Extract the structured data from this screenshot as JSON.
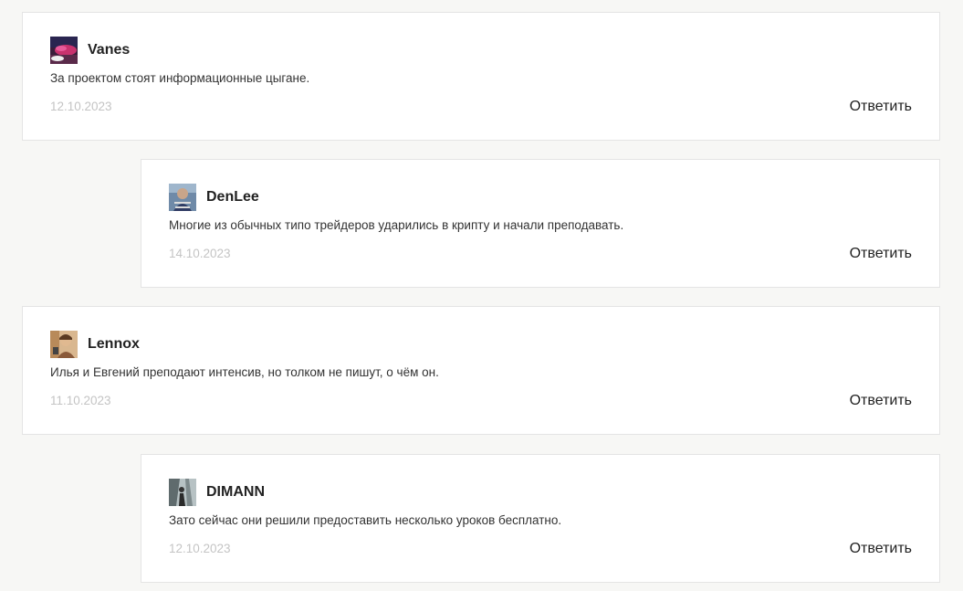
{
  "comments": [
    {
      "author": "Vanes",
      "text": "За проектом стоят информационные цыгане.",
      "date": "12.10.2023",
      "reply_label": "Ответить",
      "avatar_icon": "avatar-photo"
    },
    {
      "author": "DenLee",
      "text": "Многие из обычных типо трейдеров ударились в крипту и начали преподавать.",
      "date": "14.10.2023",
      "reply_label": "Ответить",
      "avatar_icon": "avatar-photo"
    },
    {
      "author": "Lennox",
      "text": "Илья и Евгений преподают интенсив, но толком не пишут, о чём он.",
      "date": "11.10.2023",
      "reply_label": "Ответить",
      "avatar_icon": "avatar-photo"
    },
    {
      "author": "DIMANN",
      "text": "Зато сейчас они решили предоставить несколько уроков бесплатно.",
      "date": "12.10.2023",
      "reply_label": "Ответить",
      "avatar_icon": "avatar-photo"
    }
  ],
  "colors": {
    "background": "#f7f7f5",
    "card": "#ffffff",
    "border": "#e4e4e4",
    "date": "#c4c4c4"
  }
}
